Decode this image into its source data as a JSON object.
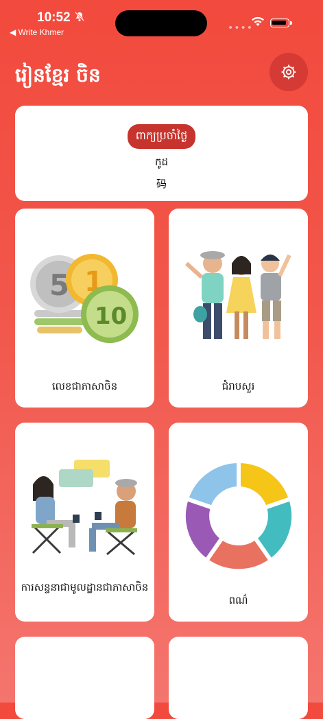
{
  "status_bar": {
    "time": "10:52",
    "back_app": "◀ Write Khmer"
  },
  "header": {
    "title": "រៀនខ្មែរ ចិន"
  },
  "phrase_card": {
    "badge": "ពាក្យប្រចាំថ្ងៃ",
    "khmer": "កូដ",
    "chinese": "码"
  },
  "categories": [
    {
      "label": "លេខជាភាសាចិន",
      "icon": "coins-illustration"
    },
    {
      "label": "ជំរាបសួរ",
      "icon": "greeting-people-illustration"
    },
    {
      "label": "ការសន្ទនាជាមូលដ្ឋានជាភាសាចិន",
      "icon": "conversation-illustration"
    },
    {
      "label": "ពណ៌",
      "icon": "color-wheel-illustration"
    },
    {
      "label": "",
      "icon": ""
    },
    {
      "label": "",
      "icon": ""
    }
  ],
  "colors": {
    "background_top": "#f24a3d",
    "background_bottom": "#f4756e",
    "badge": "#c7342d",
    "settings_button": "#d53a34"
  }
}
